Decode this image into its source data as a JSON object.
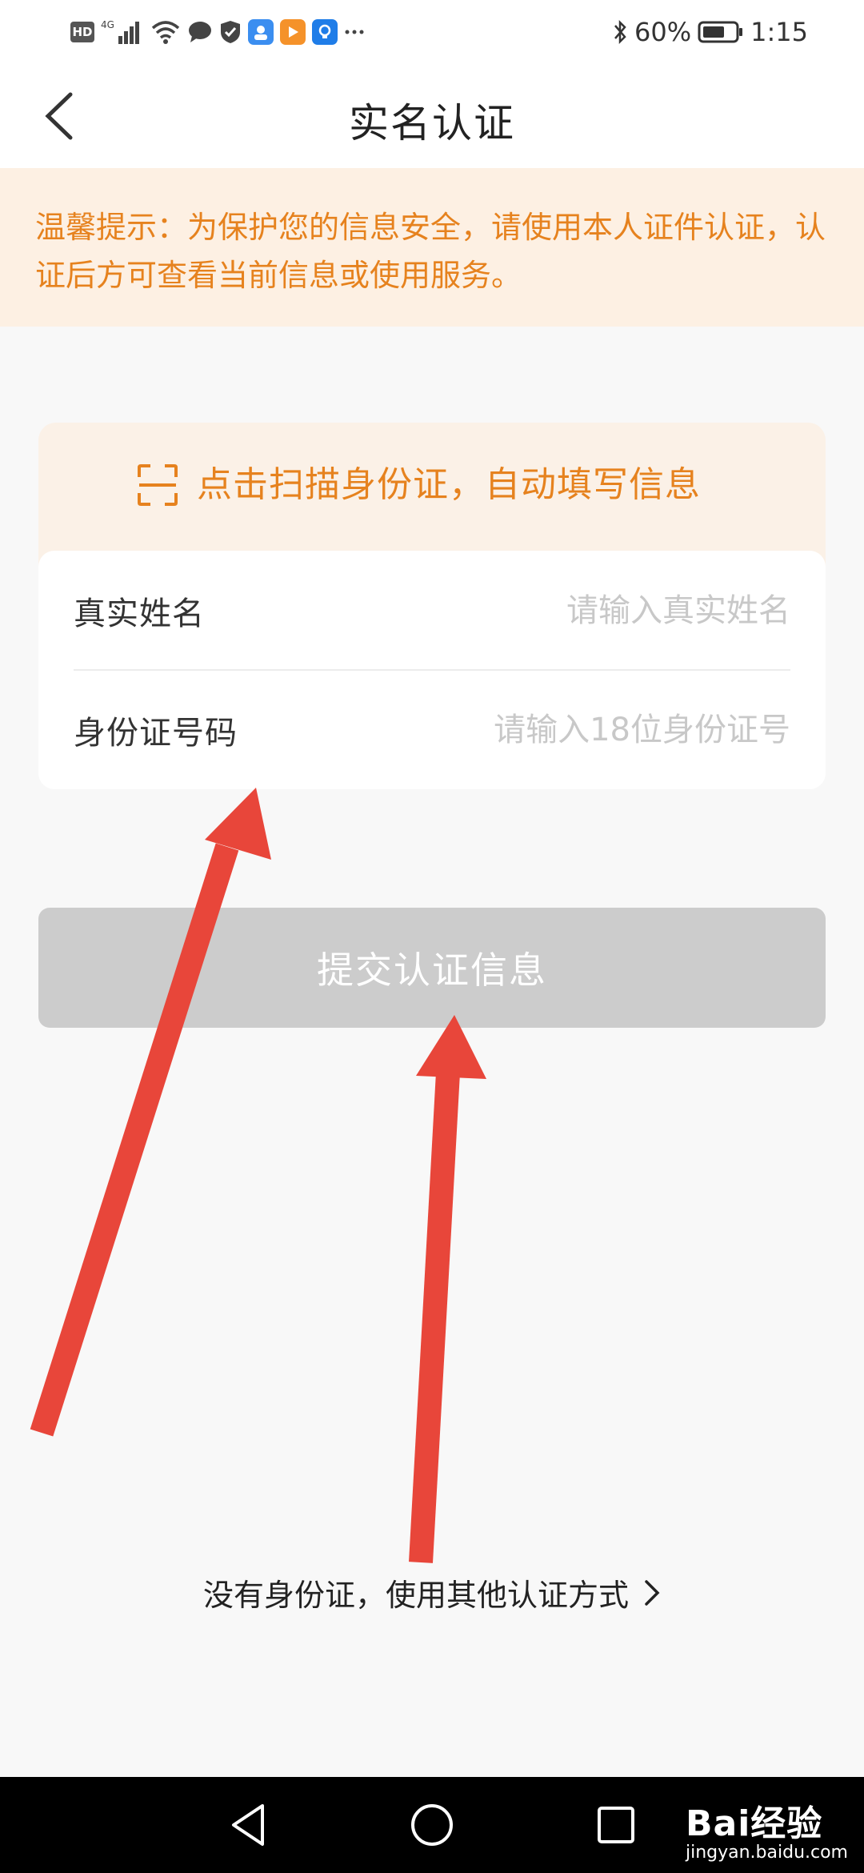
{
  "status_bar": {
    "left_badge": "HD",
    "network": "4G",
    "battery": "60%",
    "time": "1:15"
  },
  "header": {
    "title": "实名认证"
  },
  "notice": {
    "text": "温馨提示：为保护您的信息安全，请使用本人证件认证，认证后方可查看当前信息或使用服务。"
  },
  "scan": {
    "label": "点击扫描身份证，自动填写信息"
  },
  "form": {
    "name_label": "真实姓名",
    "name_placeholder": "请输入真实姓名",
    "id_label": "身份证号码",
    "id_placeholder": "请输入18位身份证号"
  },
  "submit": {
    "label": "提交认证信息"
  },
  "alt_auth": {
    "label": "没有身份证，使用其他认证方式"
  },
  "watermark": {
    "logo": "Bai经验",
    "url": "jingyan.baidu.com"
  },
  "colors": {
    "accent": "#e6821e",
    "notice_bg": "#fdf0e3",
    "disabled_button": "#cccccc",
    "annotation_arrow": "#e8463a"
  },
  "icons": {
    "back": "chevron-left-icon",
    "scan": "scan-frame-icon",
    "alt_chevron": "chevron-right-icon",
    "nav_back": "triangle-back-icon",
    "nav_home": "circle-home-icon",
    "nav_recents": "square-recents-icon"
  }
}
